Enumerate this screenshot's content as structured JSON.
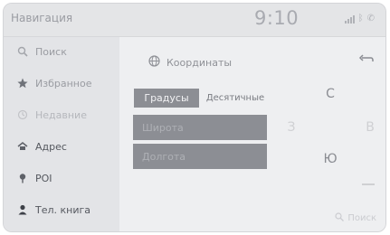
{
  "status_bar": {
    "title": "Навигация",
    "clock": "9:10"
  },
  "sidebar": {
    "items": [
      {
        "label": "Поиск",
        "icon": "search-icon"
      },
      {
        "label": "Избранное",
        "icon": "star-icon"
      },
      {
        "label": "Недавние",
        "icon": "recent-icon"
      },
      {
        "label": "Адрес",
        "icon": "address-icon"
      },
      {
        "label": "POI",
        "icon": "poi-pin-icon"
      },
      {
        "label": "Тел. книга",
        "icon": "person-icon"
      }
    ]
  },
  "main": {
    "header_title": "Координаты",
    "format_buttons": {
      "active": "Градусы",
      "inactive": "Десятичные"
    },
    "fields": {
      "latitude_placeholder": "Широта",
      "longitude_placeholder": "Долгота"
    },
    "directions": {
      "north": "С",
      "west": "З",
      "east": "В",
      "south": "Ю"
    },
    "search_label": "Поиск"
  },
  "colors": {
    "active_button": "#8c8e94",
    "background": "#eeeff1",
    "sidebar": "#e3e4e7"
  }
}
